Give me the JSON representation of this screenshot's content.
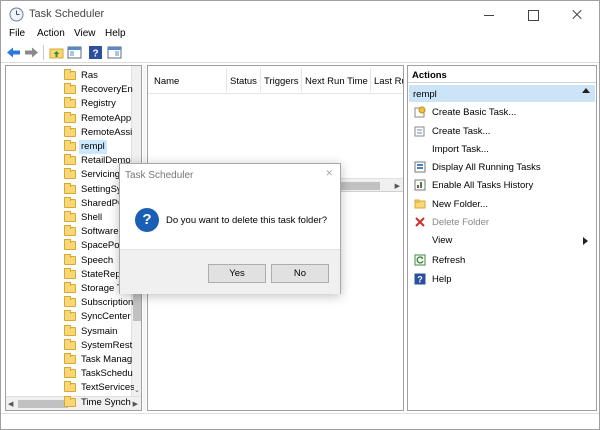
{
  "window": {
    "title": "Task Scheduler"
  },
  "menu": [
    "File",
    "Action",
    "View",
    "Help"
  ],
  "toolbar": [
    "back-arrow-icon",
    "forward-arrow-icon",
    "up-folder-icon",
    "show-hide-tree-icon",
    "help-icon",
    "show-hide-action-pane-icon"
  ],
  "tree": {
    "items": [
      "Ras",
      "RecoveryEn",
      "Registry",
      "RemoteApp",
      "RemoteAssi",
      "rempl",
      "RetailDemo",
      "Servicing",
      "SettingSy",
      "SharedPC",
      "Shell",
      "SoftwareP",
      "SpacePort",
      "Speech",
      "StateRepo",
      "Storage T",
      "Subscription",
      "SyncCenter",
      "Sysmain",
      "SystemRest",
      "Task Manag",
      "TaskSchedu",
      "TextServices",
      "Time Synch"
    ],
    "selected_index": 5
  },
  "grid": {
    "columns": [
      "Name",
      "Status",
      "Triggers",
      "Next Run Time",
      "Last Ru"
    ]
  },
  "actions": {
    "header": "Actions",
    "subheader": "rempl",
    "items": [
      {
        "label": "Create Basic Task...",
        "icon": "create-basic-task-icon",
        "enabled": true
      },
      {
        "label": "Create Task...",
        "icon": "create-task-icon",
        "enabled": true
      },
      {
        "label": "Import Task...",
        "icon": "",
        "enabled": true
      },
      {
        "label": "Display All Running Tasks",
        "icon": "running-tasks-icon",
        "enabled": true
      },
      {
        "label": "Enable All Tasks History",
        "icon": "tasks-history-icon",
        "enabled": true
      },
      {
        "label": "New Folder...",
        "icon": "new-folder-icon",
        "enabled": true
      },
      {
        "label": "Delete Folder",
        "icon": "delete-icon",
        "enabled": false
      },
      {
        "label": "View",
        "icon": "",
        "enabled": true,
        "submenu": true
      },
      {
        "label": "Refresh",
        "icon": "refresh-icon",
        "enabled": true
      },
      {
        "label": "Help",
        "icon": "help-icon",
        "enabled": true
      }
    ]
  },
  "dialog": {
    "title": "Task Scheduler",
    "message": "Do you want to delete this task folder?",
    "yes_label": "Yes",
    "no_label": "No"
  },
  "colors": {
    "selection": "#cce8ff",
    "actions_subheader": "#cce4f7",
    "question_icon": "#1b5fb5",
    "toolbar_arrow": "#2b7bd6",
    "delete_icon": "#d32f2f",
    "folder": "#f8d776"
  }
}
